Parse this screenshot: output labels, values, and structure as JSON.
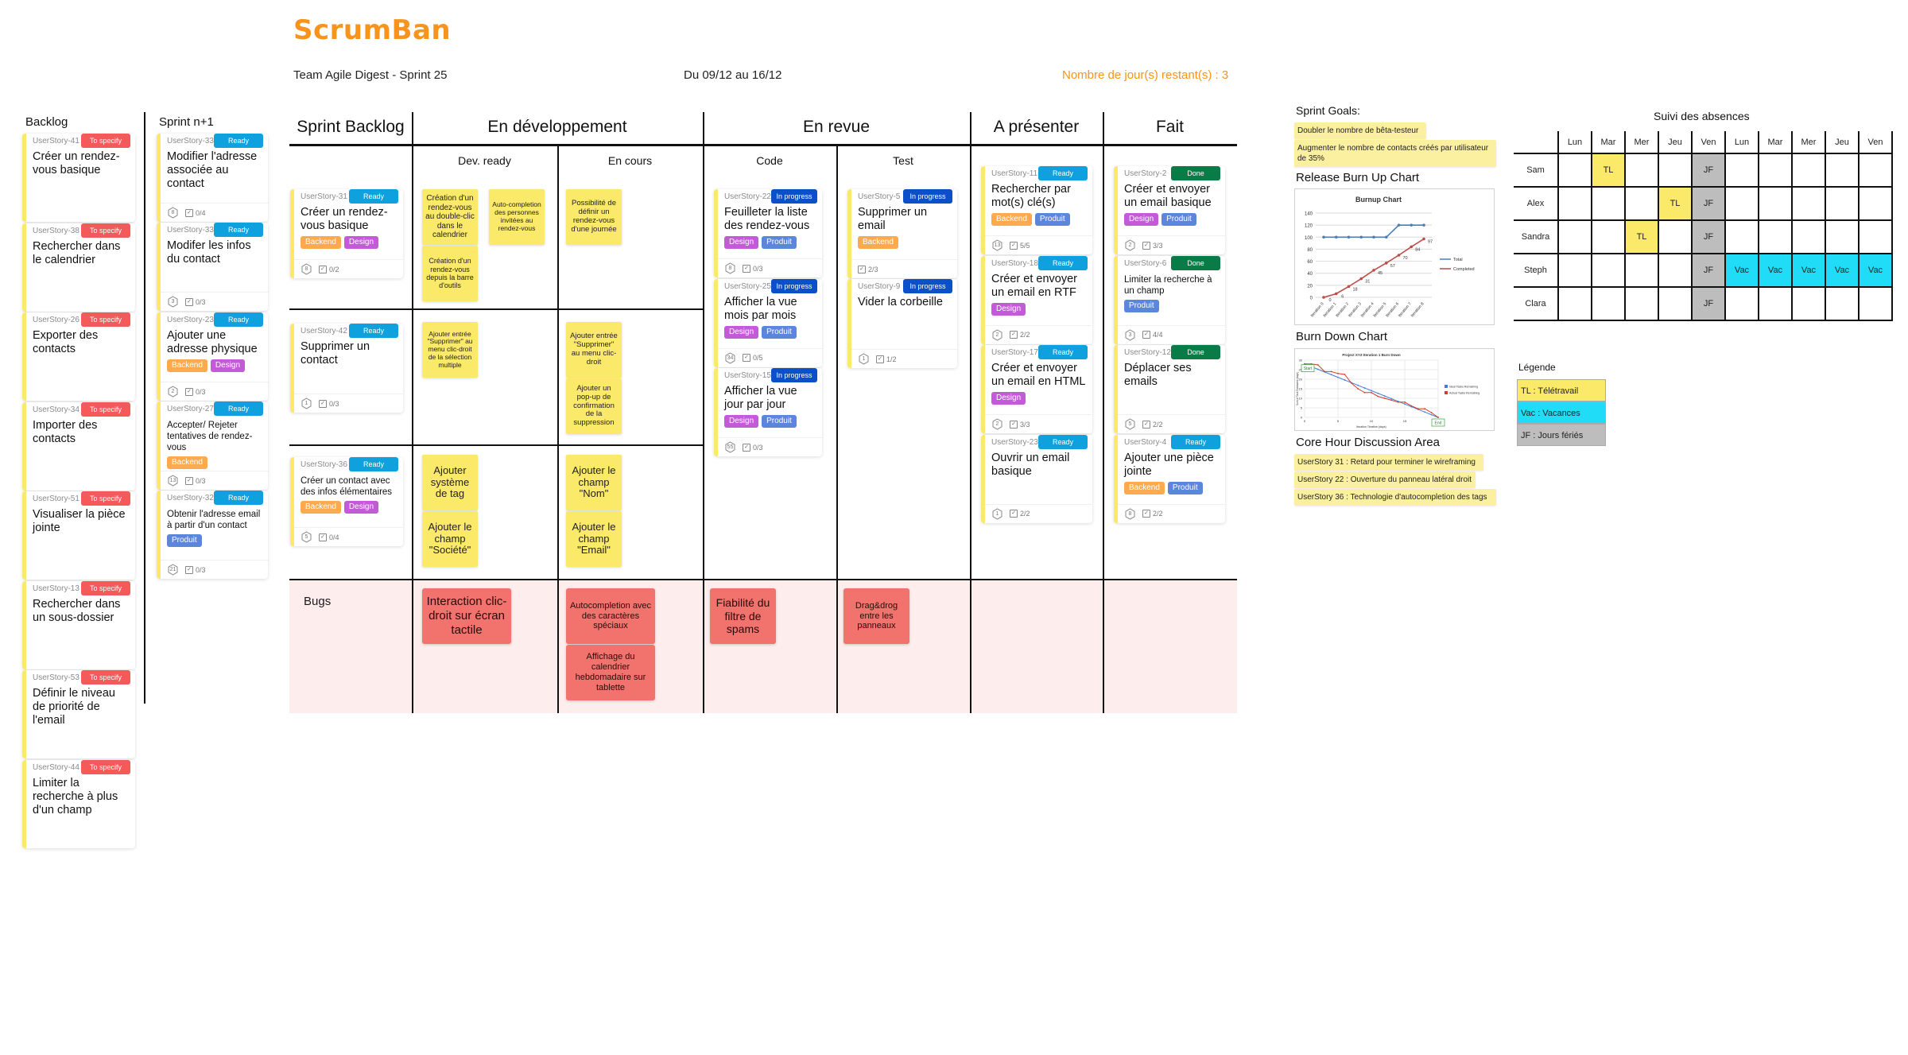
{
  "app": {
    "title": "ScrumBan"
  },
  "header": {
    "team_sprint": "Team Agile Digest - Sprint 25",
    "dates": "Du 09/12 au 16/12",
    "days_left": "Nombre de jour(s) restant(s) : 3"
  },
  "backlog": {
    "label": "Backlog",
    "cards": [
      {
        "id": "UserStory-41",
        "status": "To specify",
        "title": "Créer un rendez-vous basique"
      },
      {
        "id": "UserStory-38",
        "status": "To specify",
        "title": "Rechercher dans le calendrier"
      },
      {
        "id": "UserStory-26",
        "status": "To specify",
        "title": "Exporter des contacts"
      },
      {
        "id": "UserStory-34",
        "status": "To specify",
        "title": "Importer des contacts"
      },
      {
        "id": "UserStory-51",
        "status": "To specify",
        "title": "Visualiser la pièce jointe"
      },
      {
        "id": "UserStory-13",
        "status": "To specify",
        "title": "Rechercher dans un sous-dossier"
      },
      {
        "id": "UserStory-53",
        "status": "To specify",
        "title": "Définir le niveau de priorité de l'email"
      },
      {
        "id": "UserStory-44",
        "status": "To specify",
        "title": "Limiter la recherche à plus d'un champ"
      }
    ]
  },
  "sprint_next": {
    "label": "Sprint n+1",
    "cards": [
      {
        "id": "UserStory-33",
        "status": "Ready",
        "title": "Modifier l'adresse associée au contact",
        "tags": [],
        "points": "8",
        "tasks": "0/4"
      },
      {
        "id": "UserStory-33",
        "status": "Ready",
        "title": "Modifer les infos du contact",
        "tags": [],
        "points": "3",
        "tasks": "0/3"
      },
      {
        "id": "UserStory-23",
        "status": "Ready",
        "title": "Ajouter une adresse physique",
        "tags": [
          "Backend",
          "Design"
        ],
        "points": "2",
        "tasks": "0/3"
      },
      {
        "id": "UserStory-27",
        "status": "Ready",
        "title": "Accepter/ Rejeter tentatives de rendez-vous",
        "tags": [
          "Backend"
        ],
        "points": "13",
        "tasks": "0/3"
      },
      {
        "id": "UserStory-32",
        "status": "Ready",
        "title": "Obtenir l'adresse email à partir d'un contact",
        "tags": [
          "Produit"
        ],
        "points": "21",
        "tasks": "0/3"
      }
    ]
  },
  "board": {
    "columns": {
      "sprint_backlog": "Sprint Backlog",
      "en_dev": "En développement",
      "en_revue": "En revue",
      "a_presenter": "A présenter",
      "fait": "Fait"
    },
    "subcolumns": {
      "dev_ready": "Dev. ready",
      "en_cours": "En cours",
      "code": "Code",
      "test": "Test"
    },
    "sprint_backlog_cards": [
      {
        "id": "UserStory-31",
        "status": "Ready",
        "title": "Créer un rendez-vous basique",
        "tags": [
          "Backend",
          "Design"
        ],
        "points": "8",
        "tasks": "0/2"
      },
      {
        "id": "UserStory-42",
        "status": "Ready",
        "title": "Supprimer un contact",
        "tags": [],
        "points": "1",
        "tasks": "0/3"
      },
      {
        "id": "UserStory-36",
        "status": "Ready",
        "title": "Créer un contact avec des infos élémentaires",
        "tags": [
          "Backend",
          "Design"
        ],
        "points": "5",
        "tasks": "0/4"
      }
    ],
    "stickies": {
      "row1_dev_ready": [
        "Création d'un rendez-vous au double-clic dans le calendrier",
        "Auto-completion des personnes invitées au rendez-vous",
        "Création d'un rendez-vous depuis la barre d'outils"
      ],
      "row1_en_cours": [
        "Possibilité de définir un rendez-vous d'une journée"
      ],
      "row2_dev_ready": [
        "Ajouter entrée \"Supprimer\" au menu clic-droit de la sélection multiple"
      ],
      "row2_en_cours": [
        "Ajouter entrée \"Supprimer\" au menu clic-droit",
        "Ajouter un pop-up de confirmation de la suppression"
      ],
      "row3_dev_ready": [
        "Ajouter système de tag",
        "Ajouter le champ \"Société\""
      ],
      "row3_en_cours": [
        "Ajouter le champ \"Nom\"",
        "Ajouter le champ \"Email\""
      ]
    },
    "code_cards": [
      {
        "id": "UserStory-22",
        "status": "In progress",
        "title": "Feuilleter la liste des rendez-vous",
        "tags": [
          "Design",
          "Produit"
        ],
        "points": "8",
        "tasks": "0/3"
      },
      {
        "id": "UserStory-25",
        "status": "In progress",
        "title": "Afficher la vue mois par mois",
        "tags": [
          "Design",
          "Produit"
        ],
        "points": "34",
        "tasks": "0/5"
      },
      {
        "id": "UserStory-15",
        "status": "In progress",
        "title": "Afficher la vue jour par jour",
        "tags": [
          "Design",
          "Produit"
        ],
        "points": "55",
        "tasks": "0/3"
      }
    ],
    "test_cards": [
      {
        "id": "UserStory-5",
        "status": "In progress",
        "title": "Supprimer un email",
        "tags": [
          "Backend"
        ],
        "points": "",
        "tasks": "2/3"
      },
      {
        "id": "UserStory-9",
        "status": "In progress",
        "title": "Vider la corbeille",
        "tags": [],
        "points": "1",
        "tasks": "1/2"
      }
    ],
    "present_cards": [
      {
        "id": "UserStory-11",
        "status": "Ready",
        "title": "Rechercher par mot(s) clé(s)",
        "tags": [
          "Backend",
          "Produit"
        ],
        "points": "13",
        "tasks": "5/5"
      },
      {
        "id": "UserStory-18",
        "status": "Ready",
        "title": "Créer et envoyer un email en RTF",
        "tags": [
          "Design"
        ],
        "points": "2",
        "tasks": "2/2"
      },
      {
        "id": "UserStory-17",
        "status": "Ready",
        "title": "Créer et envoyer un email en HTML",
        "tags": [
          "Design"
        ],
        "points": "2",
        "tasks": "3/3"
      },
      {
        "id": "UserStory-23",
        "status": "Ready",
        "title": "Ouvrir un email basique",
        "tags": [],
        "points": "1",
        "tasks": "2/2"
      }
    ],
    "done_cards": [
      {
        "id": "UserStory-2",
        "status": "Done",
        "title": "Créer et envoyer un email basique",
        "tags": [
          "Design",
          "Produit"
        ],
        "points": "2",
        "tasks": "3/3"
      },
      {
        "id": "UserStory-6",
        "status": "Done",
        "title": "Limiter la recherche à un champ",
        "tags": [
          "Produit"
        ],
        "points": "3",
        "tasks": "4/4"
      },
      {
        "id": "UserStory-12",
        "status": "Done",
        "title": "Déplacer ses emails",
        "tags": [],
        "points": "5",
        "tasks": "2/2"
      },
      {
        "id": "UserStory-4",
        "status": "Ready",
        "title": "Ajouter une pièce jointe",
        "tags": [
          "Backend",
          "Produit"
        ],
        "points": "8",
        "tasks": "2/2"
      }
    ],
    "bugs": {
      "label": "Bugs",
      "dev_ready": [
        "Interaction clic-droit sur écran tactile"
      ],
      "en_cours": [
        "Autocompletion avec des caractères spéciaux",
        "Affichage du calendrier hebdomadaire sur tablette"
      ],
      "code": [
        "Fiabilité du filtre de spams"
      ],
      "test": [
        "Drag&drog entre les panneaux"
      ]
    }
  },
  "sprint_goals": {
    "label": "Sprint Goals:",
    "items": [
      "Doubler le nombre de bêta-testeur",
      "Augmenter le nombre de contacts créés par utilisateur de 35%"
    ]
  },
  "burnup": {
    "label": "Release Burn Up Chart"
  },
  "burndown": {
    "label": "Burn Down Chart"
  },
  "core_hour": {
    "label": "Core Hour Discussion Area",
    "items": [
      "UserStory 31 : Retard pour terminer le wireframing",
      "UserStory 22 : Ouverture du panneau latéral droit",
      "UserStory 36 : Technologie d'autocompletion des tags"
    ]
  },
  "absences": {
    "title": "Suivi des absences",
    "days": [
      "Lun",
      "Mar",
      "Mer",
      "Jeu",
      "Ven",
      "Lun",
      "Mar",
      "Mer",
      "Jeu",
      "Ven"
    ],
    "rows": [
      {
        "name": "Sam",
        "cells": [
          "",
          "TL",
          "",
          "",
          "JF",
          "",
          "",
          "",
          "",
          ""
        ]
      },
      {
        "name": "Alex",
        "cells": [
          "",
          "",
          "",
          "TL",
          "JF",
          "",
          "",
          "",
          "",
          ""
        ]
      },
      {
        "name": "Sandra",
        "cells": [
          "",
          "",
          "TL",
          "",
          "JF",
          "",
          "",
          "",
          "",
          ""
        ]
      },
      {
        "name": "Steph",
        "cells": [
          "",
          "",
          "",
          "",
          "JF",
          "Vac",
          "Vac",
          "Vac",
          "Vac",
          "Vac"
        ]
      },
      {
        "name": "Clara",
        "cells": [
          "",
          "",
          "",
          "",
          "JF",
          "",
          "",
          "",
          "",
          ""
        ]
      }
    ],
    "legend_title": "Légende",
    "legend": [
      {
        "code": "TL",
        "label": "TL : Télétravail",
        "color": "#fbe96a"
      },
      {
        "code": "Vac",
        "label": "Vac : Vacances",
        "color": "#20dcf7"
      },
      {
        "code": "JF",
        "label": "JF : Jours fériés",
        "color": "#bdbdbd"
      }
    ]
  },
  "colors": {
    "brand": "#f7941d",
    "to_specify": "#f55a5a",
    "ready": "#0ea1dd",
    "in_progress": "#0b4fc9",
    "done": "#087b46",
    "backend": "#fdaa4f",
    "design": "#c35ad8",
    "produit": "#5b86dc",
    "sticky": "#fbe96a",
    "bug": "#f2736d"
  },
  "chart_data": [
    {
      "type": "line",
      "title": "Burnup Chart",
      "categories": [
        "Iteration 0",
        "Iteration 1",
        "Iteration 2",
        "Iteration 3",
        "Iteration 4",
        "Iteration 5",
        "Iteration 6",
        "Iteration 7",
        "Iteration 8"
      ],
      "series": [
        {
          "name": "Total",
          "color": "#4a7ebb",
          "values": [
            100,
            100,
            100,
            100,
            100,
            100,
            120,
            120,
            120
          ]
        },
        {
          "name": "Completed",
          "color": "#be4b48",
          "values": [
            0,
            6,
            18,
            31,
            45,
            57,
            70,
            84,
            97
          ],
          "labels": true
        }
      ],
      "ylim": [
        0,
        140
      ],
      "yticks": [
        0,
        20,
        40,
        60,
        80,
        100,
        120,
        140
      ],
      "grid": true,
      "legend": "right",
      "xlabel": "",
      "ylabel": ""
    },
    {
      "type": "line",
      "title": "Project XYZ Iteration 1 Burn Down",
      "x": [
        0,
        1,
        2,
        3,
        4,
        5,
        6,
        7,
        8,
        9,
        10,
        11,
        12,
        13,
        14,
        15,
        16,
        17,
        18,
        19,
        20
      ],
      "series": [
        {
          "name": "Ideal Tasks Remaining",
          "color": "#3f7fd9",
          "values": [
            28,
            26.6,
            25.2,
            23.8,
            22.4,
            21,
            19.6,
            18.2,
            16.8,
            15.4,
            14,
            12.6,
            11.2,
            9.8,
            8.4,
            7,
            5.6,
            4.2,
            2.8,
            1.4,
            0
          ]
        },
        {
          "name": "Actual Tasks Remaining",
          "color": "#d63b26",
          "values": [
            28,
            28,
            27.5,
            24,
            24,
            23,
            22.5,
            18,
            15,
            13,
            13,
            11,
            10,
            9,
            8,
            8,
            6,
            4.5,
            4.5,
            2.5,
            0
          ]
        }
      ],
      "xlim": [
        0,
        20
      ],
      "ylim": [
        0,
        30
      ],
      "xticks": [
        0,
        5,
        10,
        15,
        20
      ],
      "yticks": [
        0,
        5,
        10,
        15,
        20,
        25,
        30
      ],
      "xlabel": "Iteration Timeline (days)",
      "ylabel": "Sum of Task Estimates (days)",
      "annotations": [
        "Start",
        "End"
      ],
      "grid": true,
      "legend": "right"
    }
  ]
}
